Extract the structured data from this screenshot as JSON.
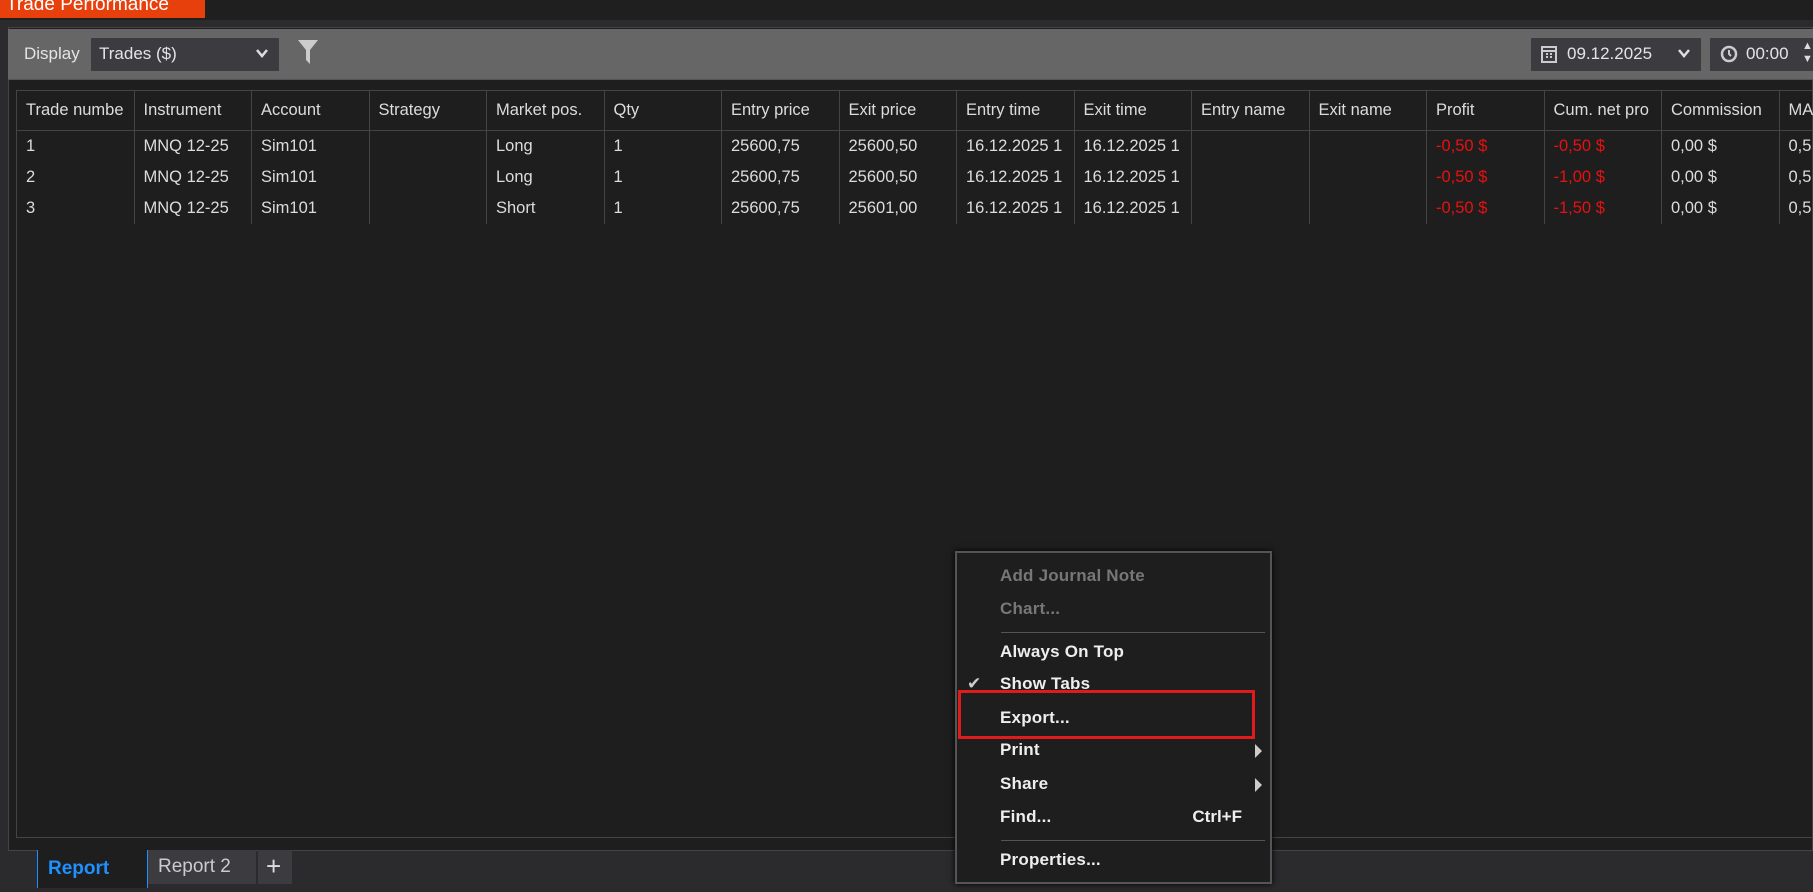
{
  "window": {
    "title": "Trade Performance"
  },
  "toolbar": {
    "display_label": "Display",
    "display_value": "Trades ($)",
    "date": "09.12.2025",
    "time": "00:00"
  },
  "table": {
    "headers": [
      "Trade numbe",
      "Instrument",
      "Account",
      "Strategy",
      "Market pos.",
      "Qty",
      "Entry price",
      "Exit price",
      "Entry time",
      "Exit time",
      "Entry name",
      "Exit name",
      "Profit",
      "Cum. net pro",
      "Commission",
      "MA"
    ],
    "rows": [
      [
        "1",
        "MNQ 12-25",
        "Sim101",
        "",
        "Long",
        "1",
        "25600,75",
        "25600,50",
        "16.12.2025 1",
        "16.12.2025 1",
        "",
        "",
        "-0,50 $",
        "-0,50 $",
        "0,00 $",
        "0,5"
      ],
      [
        "2",
        "MNQ 12-25",
        "Sim101",
        "",
        "Long",
        "1",
        "25600,75",
        "25600,50",
        "16.12.2025 1",
        "16.12.2025 1",
        "",
        "",
        "-0,50 $",
        "-1,00 $",
        "0,00 $",
        "0,5"
      ],
      [
        "3",
        "MNQ 12-25",
        "Sim101",
        "",
        "Short",
        "1",
        "25600,75",
        "25601,00",
        "16.12.2025 1",
        "16.12.2025 1",
        "",
        "",
        "-0,50 $",
        "-1,50 $",
        "0,00 $",
        "0,5"
      ]
    ]
  },
  "tabs": [
    {
      "label": "Report",
      "active": true
    },
    {
      "label": "Report 2"
    },
    {
      "label": "+"
    }
  ],
  "context_menu": {
    "add_journal_note": "Add Journal Note",
    "chart": "Chart...",
    "always_on_top": "Always On Top",
    "show_tabs": "Show Tabs",
    "show_tabs_checked": true,
    "export": "Export...",
    "print": "Print",
    "share": "Share",
    "find": "Find...",
    "find_shortcut": "Ctrl+F",
    "properties": "Properties..."
  },
  "colors": {
    "title_tab": "#e8400c",
    "negative": "#e81010",
    "active_tab": "#1e90ff",
    "highlight_box": "#e01b1b"
  }
}
